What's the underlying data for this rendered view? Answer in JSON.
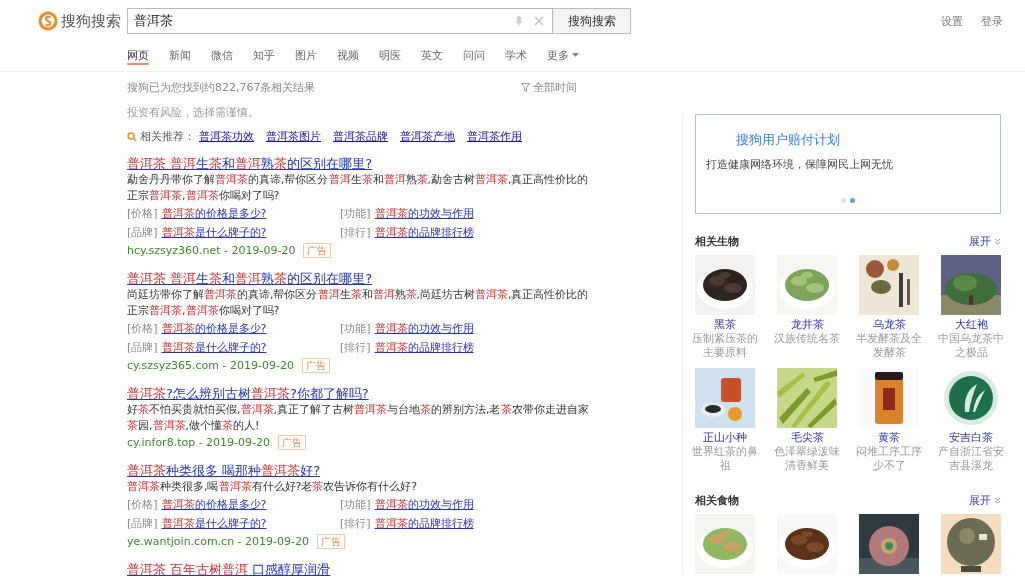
{
  "header": {
    "logo": "搜狗搜索",
    "query": "普洱茶",
    "search_button": "搜狗搜索",
    "links": [
      "设置",
      "登录"
    ]
  },
  "tabs": [
    {
      "label": "网页",
      "selected": true
    },
    {
      "label": "新闻",
      "selected": false
    },
    {
      "label": "微信",
      "selected": false
    },
    {
      "label": "知乎",
      "selected": false
    },
    {
      "label": "图片",
      "selected": false
    },
    {
      "label": "视频",
      "selected": false
    },
    {
      "label": "明医",
      "selected": false
    },
    {
      "label": "英文",
      "selected": false
    },
    {
      "label": "问问",
      "selected": false
    },
    {
      "label": "学术",
      "selected": false
    },
    {
      "label": "更多",
      "selected": false,
      "kind": "dropdown"
    }
  ],
  "result_count": "搜狗已为您找到约822,767条相关结果",
  "time_filter": "全部时间",
  "notice": "投资有风险，选择需谨慎。",
  "related": {
    "label": "相关推荐：",
    "links": [
      "普洱茶功效",
      "普洱茶图片",
      "普洱茶品牌",
      "普洱茶产地",
      "普洱茶作用"
    ]
  },
  "results": [
    {
      "title": [
        {
          "text": "普洱茶 普洱",
          "highlighted": true
        },
        {
          "text": "生",
          "highlighted": false
        },
        {
          "text": "茶",
          "highlighted": true
        },
        {
          "text": "和",
          "highlighted": false
        },
        {
          "text": "普洱",
          "highlighted": true
        },
        {
          "text": "熟",
          "highlighted": false
        },
        {
          "text": "茶",
          "highlighted": true
        },
        {
          "text": "的区别在哪里?",
          "highlighted": false
        }
      ],
      "snippet": [
        {
          "text": "勐舍丹丹带你了解",
          "highlighted": false
        },
        {
          "text": "普洱茶",
          "highlighted": true
        },
        {
          "text": "的真谛,帮你区分",
          "highlighted": false
        },
        {
          "text": "普洱",
          "highlighted": true
        },
        {
          "text": "生",
          "highlighted": false
        },
        {
          "text": "茶",
          "highlighted": true
        },
        {
          "text": "和",
          "highlighted": false
        },
        {
          "text": "普洱",
          "highlighted": true
        },
        {
          "text": "熟",
          "highlighted": false
        },
        {
          "text": "茶",
          "highlighted": true
        },
        {
          "text": ",勐舍古树",
          "highlighted": false
        },
        {
          "text": "普洱茶",
          "highlighted": true
        },
        {
          "text": ",真正高性价比的正宗",
          "highlighted": false
        },
        {
          "text": "普洱茶",
          "highlighted": true
        },
        {
          "text": ",",
          "highlighted": false
        },
        {
          "text": "普洱茶",
          "highlighted": true
        },
        {
          "text": "你喝对了吗?",
          "highlighted": false
        }
      ],
      "sublinks": [
        {
          "label": "[价格]",
          "link": [
            {
              "text": "普洱茶",
              "highlighted": true
            },
            {
              "text": "的价格是多少?",
              "highlighted": false
            }
          ]
        },
        {
          "label": "[功能]",
          "link": [
            {
              "text": "普洱茶",
              "highlighted": true
            },
            {
              "text": "的功效与作用",
              "highlighted": false
            }
          ]
        },
        {
          "label": "[品牌]",
          "link": [
            {
              "text": "普洱茶",
              "highlighted": true
            },
            {
              "text": "是什么牌子的?",
              "highlighted": false
            }
          ]
        },
        {
          "label": "[排行]",
          "link": [
            {
              "text": "普洱茶",
              "highlighted": true
            },
            {
              "text": "的品牌排行榜",
              "highlighted": false
            }
          ]
        }
      ],
      "source": "hcy.szsyz360.net - 2019-09-20",
      "badge": "广告"
    },
    {
      "title": [
        {
          "text": "普洱茶 普洱",
          "highlighted": true
        },
        {
          "text": "生",
          "highlighted": false
        },
        {
          "text": "茶",
          "highlighted": true
        },
        {
          "text": "和",
          "highlighted": false
        },
        {
          "text": "普洱",
          "highlighted": true
        },
        {
          "text": "熟",
          "highlighted": false
        },
        {
          "text": "茶",
          "highlighted": true
        },
        {
          "text": "的区别在哪里?",
          "highlighted": false
        }
      ],
      "snippet": [
        {
          "text": "尚廷坊带你了解",
          "highlighted": false
        },
        {
          "text": "普洱茶",
          "highlighted": true
        },
        {
          "text": "的真谛,帮你区分",
          "highlighted": false
        },
        {
          "text": "普洱",
          "highlighted": true
        },
        {
          "text": "生",
          "highlighted": false
        },
        {
          "text": "茶",
          "highlighted": true
        },
        {
          "text": "和",
          "highlighted": false
        },
        {
          "text": "普洱",
          "highlighted": true
        },
        {
          "text": "熟",
          "highlighted": false
        },
        {
          "text": "茶",
          "highlighted": true
        },
        {
          "text": ",尚廷坊古树",
          "highlighted": false
        },
        {
          "text": "普洱茶",
          "highlighted": true
        },
        {
          "text": ",真正高性价比的正宗",
          "highlighted": false
        },
        {
          "text": "普洱茶",
          "highlighted": true
        },
        {
          "text": ",",
          "highlighted": false
        },
        {
          "text": "普洱茶",
          "highlighted": true
        },
        {
          "text": "你喝对了吗?",
          "highlighted": false
        }
      ],
      "sublinks": [
        {
          "label": "[价格]",
          "link": [
            {
              "text": "普洱茶",
              "highlighted": true
            },
            {
              "text": "的价格是多少?",
              "highlighted": false
            }
          ]
        },
        {
          "label": "[功能]",
          "link": [
            {
              "text": "普洱茶",
              "highlighted": true
            },
            {
              "text": "的功效与作用",
              "highlighted": false
            }
          ]
        },
        {
          "label": "[品牌]",
          "link": [
            {
              "text": "普洱茶",
              "highlighted": true
            },
            {
              "text": "是什么牌子的?",
              "highlighted": false
            }
          ]
        },
        {
          "label": "[排行]",
          "link": [
            {
              "text": "普洱茶",
              "highlighted": true
            },
            {
              "text": "的品牌排行榜",
              "highlighted": false
            }
          ]
        }
      ],
      "source": "cy.szsyz365.com - 2019-09-20",
      "badge": "广告"
    },
    {
      "title": [
        {
          "text": "普洱茶",
          "highlighted": true
        },
        {
          "text": "?怎么辨别古树",
          "highlighted": false
        },
        {
          "text": "普洱茶",
          "highlighted": true
        },
        {
          "text": "?你都了解吗?",
          "highlighted": false
        }
      ],
      "snippet": [
        {
          "text": "好",
          "highlighted": false
        },
        {
          "text": "茶",
          "highlighted": true
        },
        {
          "text": "不怕买贵就怕买假,",
          "highlighted": false
        },
        {
          "text": "普洱茶",
          "highlighted": true
        },
        {
          "text": ",真正了解了古树",
          "highlighted": false
        },
        {
          "text": "普洱茶",
          "highlighted": true
        },
        {
          "text": "与台地",
          "highlighted": false
        },
        {
          "text": "茶",
          "highlighted": true
        },
        {
          "text": "的辨别方法,老",
          "highlighted": false
        },
        {
          "text": "茶",
          "highlighted": true
        },
        {
          "text": "农带你走进自家",
          "highlighted": false
        },
        {
          "text": "茶",
          "highlighted": true
        },
        {
          "text": "园,",
          "highlighted": false
        },
        {
          "text": "普洱茶",
          "highlighted": true
        },
        {
          "text": ",做个懂",
          "highlighted": false
        },
        {
          "text": "茶",
          "highlighted": true
        },
        {
          "text": "的人!",
          "highlighted": false
        }
      ],
      "source": "cy.infor8.top - 2019-09-20",
      "badge": "广告"
    },
    {
      "title": [
        {
          "text": "普洱茶",
          "highlighted": true
        },
        {
          "text": "种类很多 喝那种",
          "highlighted": false
        },
        {
          "text": "普洱茶",
          "highlighted": true
        },
        {
          "text": "好?",
          "highlighted": false
        }
      ],
      "snippet": [
        {
          "text": "普洱茶",
          "highlighted": true
        },
        {
          "text": "种类很多,喝",
          "highlighted": false
        },
        {
          "text": "普洱茶",
          "highlighted": true
        },
        {
          "text": "有什么好?老",
          "highlighted": false
        },
        {
          "text": "茶",
          "highlighted": true
        },
        {
          "text": "农告诉你有什么好?",
          "highlighted": false
        }
      ],
      "sublinks": [
        {
          "label": "[价格]",
          "link": [
            {
              "text": "普洱茶",
              "highlighted": true
            },
            {
              "text": "的价格是多少?",
              "highlighted": false
            }
          ]
        },
        {
          "label": "[功能]",
          "link": [
            {
              "text": "普洱茶",
              "highlighted": true
            },
            {
              "text": "的功效与作用",
              "highlighted": false
            }
          ]
        },
        {
          "label": "[品牌]",
          "link": [
            {
              "text": "普洱茶",
              "highlighted": true
            },
            {
              "text": "是什么牌子的?",
              "highlighted": false
            }
          ]
        },
        {
          "label": "[排行]",
          "link": [
            {
              "text": "普洱茶",
              "highlighted": true
            },
            {
              "text": "的品牌排行榜",
              "highlighted": false
            }
          ]
        }
      ],
      "source": "ye.wantjoin.com.cn - 2019-09-20",
      "badge": "广告"
    },
    {
      "title": [
        {
          "text": "普洱茶 百年古树普洱",
          "highlighted": true
        },
        {
          "text": " 口感醇厚润滑",
          "highlighted": false
        }
      ]
    }
  ],
  "sidebar": {
    "promo": {
      "title": "搜狗用户赔付计划",
      "subtitle": "打造健康网络环境，保障网民上网无忧",
      "dots": [
        {
          "selected": false
        },
        {
          "selected": true
        }
      ]
    },
    "organisms": {
      "title": "相关生物",
      "expand": "展开",
      "items": [
        {
          "name": "黑茶",
          "desc": "压制紧压茶的主要原料"
        },
        {
          "name": "龙井茶",
          "desc": "汉族传统名茶"
        },
        {
          "name": "乌龙茶",
          "desc": "半发酵茶及全发酵茶"
        },
        {
          "name": "大红袍",
          "desc": "中国乌龙茶中之极品"
        },
        {
          "name": "正山小种",
          "desc": "世界红茶的鼻祖"
        },
        {
          "name": "毛尖茶",
          "desc": "色泽翠绿泼味清香鲜美"
        },
        {
          "name": "黄茶",
          "desc": "闷堆工序工序少不了"
        },
        {
          "name": "安吉白茶",
          "desc": "产自浙江省安吉县溪龙"
        }
      ]
    },
    "foods": {
      "title": "相关食物",
      "expand": "展开"
    }
  }
}
